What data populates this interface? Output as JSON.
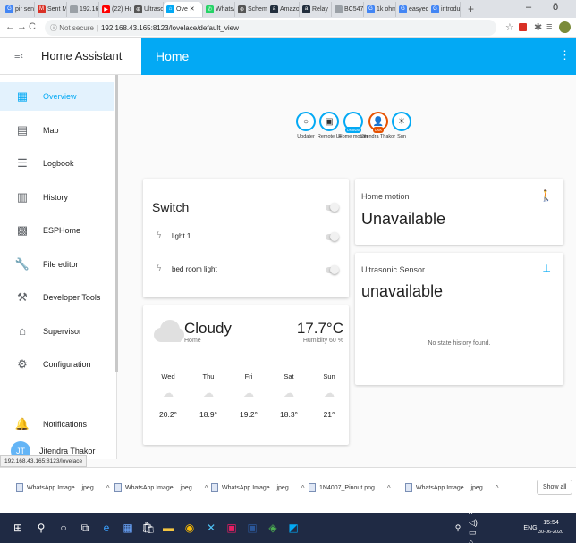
{
  "browser": {
    "tabs": [
      {
        "label": "pir sens",
        "color": "#4285f4",
        "glyph": "G"
      },
      {
        "label": "Sent M",
        "color": "#d93025",
        "glyph": "M"
      },
      {
        "label": "192.161",
        "color": "#9aa0a6",
        "glyph": ""
      },
      {
        "label": "(22) Ho",
        "color": "#ff0000",
        "glyph": "▶"
      },
      {
        "label": "Ultraso",
        "color": "#555555",
        "glyph": "⊕"
      },
      {
        "label": "Ove ✕",
        "color": "#03a9f4",
        "glyph": "⌂"
      },
      {
        "label": "WhatsA",
        "color": "#25d366",
        "glyph": "✆"
      },
      {
        "label": "Schem",
        "color": "#555555",
        "glyph": "⊛"
      },
      {
        "label": "Amazo",
        "color": "#232f3e",
        "glyph": "a"
      },
      {
        "label": "Relay",
        "color": "#232f3e",
        "glyph": "a"
      },
      {
        "label": "BC547",
        "color": "#9aa0a6",
        "glyph": ""
      },
      {
        "label": "1k ohm",
        "color": "#4285f4",
        "glyph": "G"
      },
      {
        "label": "easyed",
        "color": "#4285f4",
        "glyph": "G"
      },
      {
        "label": "introdu",
        "color": "#4285f4",
        "glyph": "G"
      }
    ],
    "new_tab": "+",
    "minimize": "–",
    "restore": "ō",
    "omnibox": {
      "security": "ⓘ Not secure",
      "separator": "|",
      "url": "192.168.43.165:8123/lovelace/default_view"
    },
    "status_url": "192.168.43.165:8123/lovelace"
  },
  "ha": {
    "menu_icon": "≡‹",
    "app_title": "Home Assistant",
    "page_title": "Home",
    "kebab": "⋮",
    "sidebar": [
      {
        "label": "Overview",
        "icon": "view-dashboard-icon",
        "glyph": "▦",
        "active": true
      },
      {
        "label": "Map",
        "icon": "map-icon",
        "glyph": "▤"
      },
      {
        "label": "Logbook",
        "icon": "logbook-icon",
        "glyph": "☰"
      },
      {
        "label": "History",
        "icon": "history-icon",
        "glyph": "▥"
      },
      {
        "label": "ESPHome",
        "icon": "esphome-icon",
        "glyph": "▩"
      },
      {
        "label": "File editor",
        "icon": "wrench-icon",
        "glyph": "🔧"
      },
      {
        "label": "Developer Tools",
        "icon": "hammer-icon",
        "glyph": "⚒"
      },
      {
        "label": "Supervisor",
        "icon": "supervisor-icon",
        "glyph": "⌂"
      },
      {
        "label": "Configuration",
        "icon": "cog-icon",
        "glyph": "⚙"
      }
    ],
    "notifications": "Notifications",
    "user": {
      "initials": "JT",
      "name": "Jitendra Thakor"
    },
    "badges": [
      {
        "label": "Updater",
        "glyph": "○"
      },
      {
        "label": "Remote UI",
        "glyph": "▣"
      },
      {
        "label": "Home motion",
        "glyph": "",
        "tag": "UNAVAI"
      },
      {
        "label": "Jitendra Thakor",
        "glyph": "👤",
        "tag": "UNK"
      },
      {
        "label": "Sun",
        "glyph": "☀"
      }
    ],
    "switch_card": {
      "title": "Switch",
      "rows": [
        {
          "label": "light 1"
        },
        {
          "label": "bed room light"
        }
      ]
    },
    "weather": {
      "condition": "Cloudy",
      "location": "Home",
      "temperature": "17.7°C",
      "humidity": "Humidity 60 %",
      "forecast": [
        {
          "day": "Wed",
          "temp": "20.2°"
        },
        {
          "day": "Thu",
          "temp": "18.9°"
        },
        {
          "day": "Fri",
          "temp": "19.2°"
        },
        {
          "day": "Sat",
          "temp": "18.3°"
        },
        {
          "day": "Sun",
          "temp": "21°"
        }
      ]
    },
    "home_motion_card": {
      "name": "Home motion",
      "state": "Unavailable"
    },
    "ultrasonic_card": {
      "name": "Ultrasonic Sensor",
      "state": "unavailable",
      "message": "No state history found."
    }
  },
  "downloads": {
    "items": [
      "WhatsApp Image....jpeg",
      "WhatsApp Image....jpeg",
      "WhatsApp Image....jpeg",
      "1N4007_Pinout.png",
      "WhatsApp Image....jpeg"
    ],
    "show_all": "Show all"
  },
  "taskbar": {
    "time": "15:54",
    "date": "30-06-2020",
    "lang": "ENG"
  },
  "colors": {
    "accent": "#03a9f4",
    "taskbar": "#1f2a44"
  }
}
